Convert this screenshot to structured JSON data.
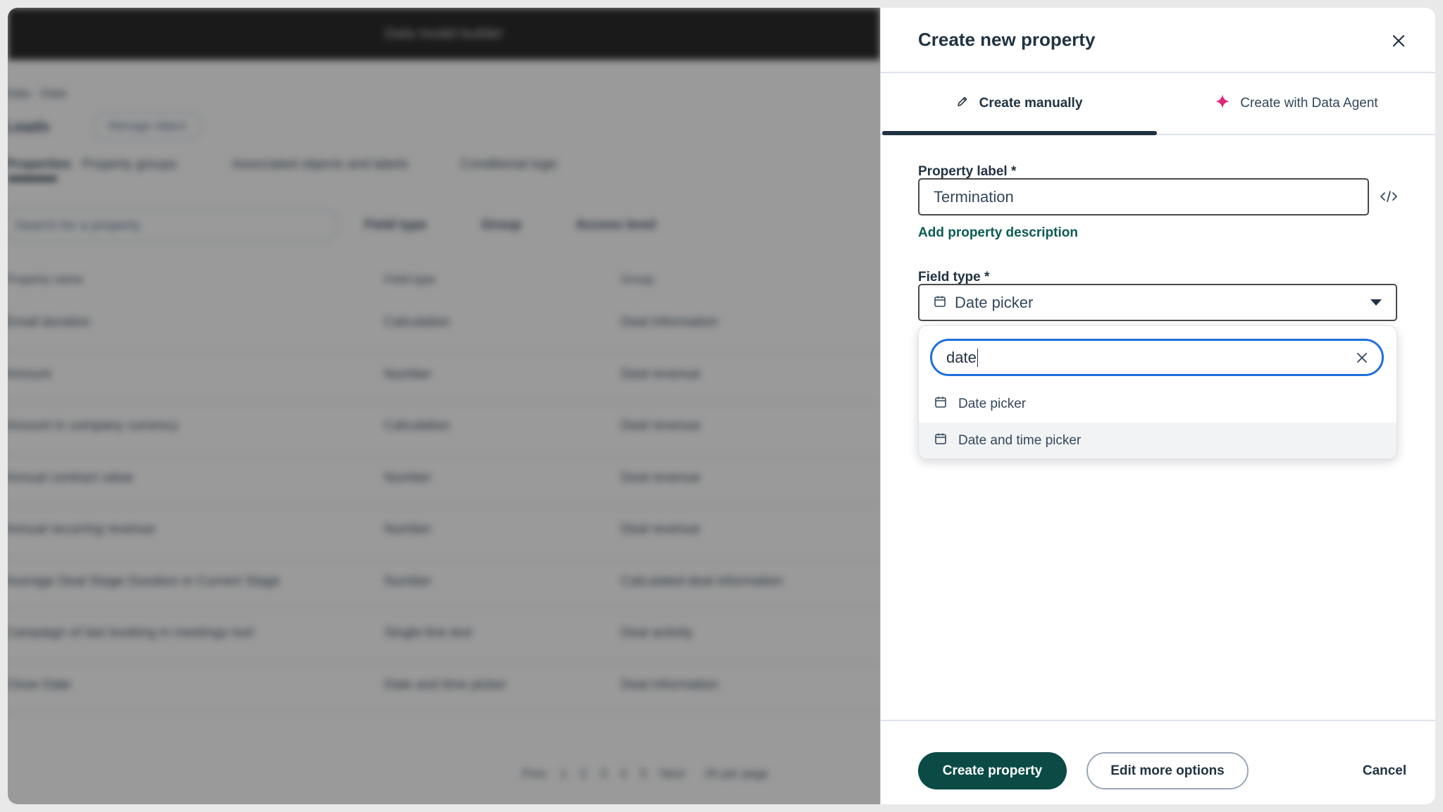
{
  "background": {
    "topbar_text": "Data model builder",
    "breadcrumb": "Data · Data",
    "object_name": "Leads",
    "manage_chip": "Manage object",
    "tabs": [
      "Properties",
      "Property groups",
      "Associated objects and labels",
      "Conditional logic"
    ],
    "search_placeholder": "Search for a property",
    "filters": [
      "Field type",
      "Group",
      "Access level"
    ],
    "columns": [
      "Property name",
      "Field type",
      "Group"
    ],
    "rows": [
      {
        "name": "Email duration",
        "type": "Calculation",
        "group": "Deal information"
      },
      {
        "name": "Amount",
        "type": "Number",
        "group": "Deal revenue"
      },
      {
        "name": "Amount in company currency",
        "type": "Calculation",
        "group": "Deal revenue"
      },
      {
        "name": "Annual contract value",
        "type": "Number",
        "group": "Deal revenue"
      },
      {
        "name": "Annual recurring revenue",
        "type": "Number",
        "group": "Deal revenue"
      },
      {
        "name": "Average Deal Stage Duration in Current Stage",
        "type": "Number",
        "group": "Calculated deal information"
      },
      {
        "name": "Campaign of last booking in meetings tool",
        "type": "Single-line text",
        "group": "Deal activity"
      },
      {
        "name": "Close Date",
        "type": "Date and time picker",
        "group": "Deal information"
      }
    ],
    "pagination": [
      "Prev",
      "1",
      "2",
      "3",
      "4",
      "5",
      "Next",
      "25 per page"
    ]
  },
  "panel": {
    "title": "Create new property",
    "tabs": {
      "manual": "Create manually",
      "agent": "Create with Data Agent"
    },
    "property_label": {
      "label": "Property label *",
      "value": "Termination"
    },
    "add_description": "Add property description",
    "field_type": {
      "label": "Field type *",
      "value": "Date picker"
    },
    "dropdown": {
      "search_value": "date",
      "options": [
        "Date picker",
        "Date and time picker"
      ]
    },
    "footer": {
      "create": "Create property",
      "edit_more": "Edit more options",
      "cancel": "Cancel"
    }
  },
  "colors": {
    "primary": "#0b4a45",
    "link": "#0b5c54",
    "focus": "#1f6fde",
    "agent_sparkle": "#e0267a"
  }
}
